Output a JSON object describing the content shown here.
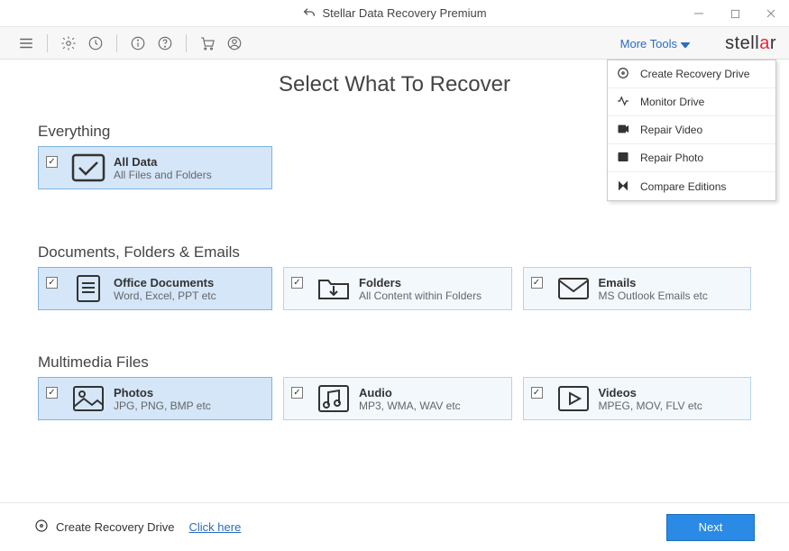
{
  "window": {
    "title": "Stellar Data Recovery Premium"
  },
  "toolbar": {
    "more_tools_label": "More Tools",
    "brand": "stellar"
  },
  "dropdown": {
    "items": [
      "Create Recovery Drive",
      "Monitor Drive",
      "Repair Video",
      "Repair Photo",
      "Compare Editions"
    ]
  },
  "page": {
    "title": "Select What To Recover",
    "sections": {
      "everything": {
        "title": "Everything",
        "card": {
          "title": "All Data",
          "sub": "All Files and Folders",
          "checked": true
        }
      },
      "docs": {
        "title": "Documents, Folders & Emails",
        "cards": [
          {
            "title": "Office Documents",
            "sub": "Word, Excel, PPT etc",
            "checked": true
          },
          {
            "title": "Folders",
            "sub": "All Content within Folders",
            "checked": true
          },
          {
            "title": "Emails",
            "sub": "MS Outlook Emails etc",
            "checked": true
          }
        ]
      },
      "media": {
        "title": "Multimedia Files",
        "cards": [
          {
            "title": "Photos",
            "sub": "JPG, PNG, BMP etc",
            "checked": true
          },
          {
            "title": "Audio",
            "sub": "MP3, WMA, WAV etc",
            "checked": true
          },
          {
            "title": "Videos",
            "sub": "MPEG, MOV, FLV etc",
            "checked": true
          }
        ]
      }
    }
  },
  "footer": {
    "label": "Create Recovery Drive",
    "link": "Click here",
    "next": "Next"
  }
}
